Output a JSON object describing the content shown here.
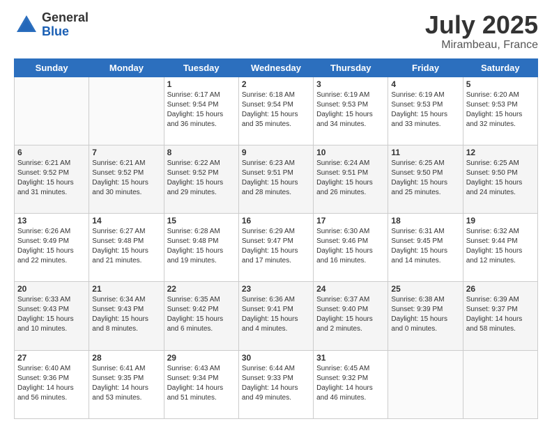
{
  "logo": {
    "general": "General",
    "blue": "Blue"
  },
  "title": "July 2025",
  "location": "Mirambeau, France",
  "weekdays": [
    "Sunday",
    "Monday",
    "Tuesday",
    "Wednesday",
    "Thursday",
    "Friday",
    "Saturday"
  ],
  "weeks": [
    [
      {
        "day": "",
        "info": ""
      },
      {
        "day": "",
        "info": ""
      },
      {
        "day": "1",
        "info": "Sunrise: 6:17 AM\nSunset: 9:54 PM\nDaylight: 15 hours and 36 minutes."
      },
      {
        "day": "2",
        "info": "Sunrise: 6:18 AM\nSunset: 9:54 PM\nDaylight: 15 hours and 35 minutes."
      },
      {
        "day": "3",
        "info": "Sunrise: 6:19 AM\nSunset: 9:53 PM\nDaylight: 15 hours and 34 minutes."
      },
      {
        "day": "4",
        "info": "Sunrise: 6:19 AM\nSunset: 9:53 PM\nDaylight: 15 hours and 33 minutes."
      },
      {
        "day": "5",
        "info": "Sunrise: 6:20 AM\nSunset: 9:53 PM\nDaylight: 15 hours and 32 minutes."
      }
    ],
    [
      {
        "day": "6",
        "info": "Sunrise: 6:21 AM\nSunset: 9:52 PM\nDaylight: 15 hours and 31 minutes."
      },
      {
        "day": "7",
        "info": "Sunrise: 6:21 AM\nSunset: 9:52 PM\nDaylight: 15 hours and 30 minutes."
      },
      {
        "day": "8",
        "info": "Sunrise: 6:22 AM\nSunset: 9:52 PM\nDaylight: 15 hours and 29 minutes."
      },
      {
        "day": "9",
        "info": "Sunrise: 6:23 AM\nSunset: 9:51 PM\nDaylight: 15 hours and 28 minutes."
      },
      {
        "day": "10",
        "info": "Sunrise: 6:24 AM\nSunset: 9:51 PM\nDaylight: 15 hours and 26 minutes."
      },
      {
        "day": "11",
        "info": "Sunrise: 6:25 AM\nSunset: 9:50 PM\nDaylight: 15 hours and 25 minutes."
      },
      {
        "day": "12",
        "info": "Sunrise: 6:25 AM\nSunset: 9:50 PM\nDaylight: 15 hours and 24 minutes."
      }
    ],
    [
      {
        "day": "13",
        "info": "Sunrise: 6:26 AM\nSunset: 9:49 PM\nDaylight: 15 hours and 22 minutes."
      },
      {
        "day": "14",
        "info": "Sunrise: 6:27 AM\nSunset: 9:48 PM\nDaylight: 15 hours and 21 minutes."
      },
      {
        "day": "15",
        "info": "Sunrise: 6:28 AM\nSunset: 9:48 PM\nDaylight: 15 hours and 19 minutes."
      },
      {
        "day": "16",
        "info": "Sunrise: 6:29 AM\nSunset: 9:47 PM\nDaylight: 15 hours and 17 minutes."
      },
      {
        "day": "17",
        "info": "Sunrise: 6:30 AM\nSunset: 9:46 PM\nDaylight: 15 hours and 16 minutes."
      },
      {
        "day": "18",
        "info": "Sunrise: 6:31 AM\nSunset: 9:45 PM\nDaylight: 15 hours and 14 minutes."
      },
      {
        "day": "19",
        "info": "Sunrise: 6:32 AM\nSunset: 9:44 PM\nDaylight: 15 hours and 12 minutes."
      }
    ],
    [
      {
        "day": "20",
        "info": "Sunrise: 6:33 AM\nSunset: 9:43 PM\nDaylight: 15 hours and 10 minutes."
      },
      {
        "day": "21",
        "info": "Sunrise: 6:34 AM\nSunset: 9:43 PM\nDaylight: 15 hours and 8 minutes."
      },
      {
        "day": "22",
        "info": "Sunrise: 6:35 AM\nSunset: 9:42 PM\nDaylight: 15 hours and 6 minutes."
      },
      {
        "day": "23",
        "info": "Sunrise: 6:36 AM\nSunset: 9:41 PM\nDaylight: 15 hours and 4 minutes."
      },
      {
        "day": "24",
        "info": "Sunrise: 6:37 AM\nSunset: 9:40 PM\nDaylight: 15 hours and 2 minutes."
      },
      {
        "day": "25",
        "info": "Sunrise: 6:38 AM\nSunset: 9:39 PM\nDaylight: 15 hours and 0 minutes."
      },
      {
        "day": "26",
        "info": "Sunrise: 6:39 AM\nSunset: 9:37 PM\nDaylight: 14 hours and 58 minutes."
      }
    ],
    [
      {
        "day": "27",
        "info": "Sunrise: 6:40 AM\nSunset: 9:36 PM\nDaylight: 14 hours and 56 minutes."
      },
      {
        "day": "28",
        "info": "Sunrise: 6:41 AM\nSunset: 9:35 PM\nDaylight: 14 hours and 53 minutes."
      },
      {
        "day": "29",
        "info": "Sunrise: 6:43 AM\nSunset: 9:34 PM\nDaylight: 14 hours and 51 minutes."
      },
      {
        "day": "30",
        "info": "Sunrise: 6:44 AM\nSunset: 9:33 PM\nDaylight: 14 hours and 49 minutes."
      },
      {
        "day": "31",
        "info": "Sunrise: 6:45 AM\nSunset: 9:32 PM\nDaylight: 14 hours and 46 minutes."
      },
      {
        "day": "",
        "info": ""
      },
      {
        "day": "",
        "info": ""
      }
    ]
  ]
}
